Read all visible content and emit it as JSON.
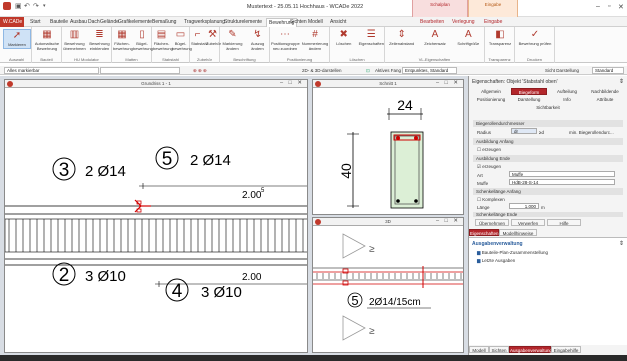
{
  "app": {
    "title": "Mustertext - 25.05.11 Hochhaus - WCADe 2022",
    "context_groups": {
      "group1": "Schalplan",
      "group2": "Eingabe"
    },
    "qat_icons": [
      "app-logo-icon",
      "save-icon",
      "undo-icon",
      "redo-icon",
      "dropdown-icon"
    ],
    "window_buttons": {
      "minimize": "–",
      "restore": "▫",
      "close": "✕"
    }
  },
  "ribbon_tabs": [
    {
      "label": "W.CADe",
      "kind": "file"
    },
    {
      "label": "Start"
    },
    {
      "label": "Bauteile"
    },
    {
      "label": "Ausbau"
    },
    {
      "label": "Dach"
    },
    {
      "label": "Gelände"
    },
    {
      "label": "Grafikelemente"
    },
    {
      "label": "Bemaßung"
    },
    {
      "label": "Tragwerksplanung"
    },
    {
      "label": "Strukturelemente"
    },
    {
      "label": "Bewehrung",
      "active": true
    },
    {
      "label": "Sichten"
    },
    {
      "label": "Modell"
    },
    {
      "label": "Ansicht"
    },
    {
      "label": "Bearbeiten",
      "context": true
    },
    {
      "label": "Verlegung",
      "context": true
    },
    {
      "label": "Eingabe",
      "context": true
    }
  ],
  "ribbon_groups": [
    {
      "label": "Auswahl",
      "buttons": [
        {
          "label": "Markieren",
          "icon": "cursor-icon",
          "glyph": "➚",
          "selected": true
        }
      ]
    },
    {
      "label": "Bauteil",
      "buttons": [
        {
          "label": "Automatische Bewehrung",
          "icon": "auto-rebar-icon",
          "glyph": "▦"
        }
      ]
    },
    {
      "label": "HU Modulator",
      "buttons": [
        {
          "label": "Bewehrung übernehmen",
          "icon": "rebar-take-icon",
          "glyph": "▥"
        },
        {
          "label": "Bewehrung einblenden",
          "icon": "rebar-show-icon",
          "glyph": "≣"
        }
      ]
    },
    {
      "label": "Matten",
      "buttons": [
        {
          "label": "Flächen-bewehrung",
          "icon": "mesh-icon",
          "glyph": "▦"
        },
        {
          "label": "Bügel-bewehrung",
          "icon": "stirrup-icon",
          "glyph": "▯"
        }
      ]
    },
    {
      "label": "Stabstahl",
      "buttons": [
        {
          "label": "Flächen-bewehrung",
          "icon": "bar-area-icon",
          "glyph": "▤"
        },
        {
          "label": "Bügel-bewehrung",
          "icon": "bar-stirrup-icon",
          "glyph": "▭"
        }
      ]
    },
    {
      "label": "Zubehör",
      "buttons": [
        {
          "label": "Stabstahl",
          "icon": "bar-icon",
          "glyph": "⌐"
        },
        {
          "label": "Zubehör",
          "icon": "accessory-icon",
          "glyph": "⚒"
        }
      ]
    },
    {
      "label": "Beschriftung",
      "buttons": [
        {
          "label": "Markierung ändern",
          "icon": "marking-icon",
          "glyph": "✎"
        },
        {
          "label": "Auszug ändern",
          "icon": "extract-icon",
          "glyph": "↯"
        }
      ]
    },
    {
      "label": "Positionierung",
      "buttons": [
        {
          "label": "Positionsgruppe neu zuordnen",
          "icon": "posgroup-icon",
          "glyph": "⋯"
        },
        {
          "label": "Nummerierung ändern",
          "icon": "numbering-icon",
          "glyph": "#"
        }
      ]
    },
    {
      "label": "Löschen",
      "buttons": [
        {
          "label": "Löschen",
          "icon": "delete-icon",
          "glyph": "✖"
        },
        {
          "label": "Eigenschaften",
          "icon": "properties-icon",
          "glyph": "☰"
        }
      ]
    },
    {
      "label": "VL-Eigenschaften",
      "buttons": [
        {
          "label": "Zeilenabstand",
          "icon": "spacing-icon",
          "glyph": "⇕"
        },
        {
          "label": "Zeichensatz",
          "icon": "font-icon",
          "glyph": "A"
        },
        {
          "label": "Schriftgröße",
          "icon": "fontsize-icon",
          "glyph": "A"
        }
      ]
    },
    {
      "label": "Transparenz",
      "buttons": [
        {
          "label": "Transparenz",
          "icon": "transparency-icon",
          "glyph": "◧"
        }
      ]
    },
    {
      "label": "Drucken",
      "buttons": [
        {
          "label": "Bewehrung prüfen",
          "icon": "check-rebar-icon",
          "glyph": "✓"
        }
      ]
    }
  ],
  "command_bar": {
    "layer_select": "Alles markierbar",
    "layer2": "",
    "mode_label": "2D- & 3D-darstellen",
    "snap_label": "Aktives Fang",
    "snap_options": "Entpunktes, Standard",
    "right_select": "Sicht Darstellung",
    "right_value": "Standard"
  },
  "views": [
    {
      "title": "Grundriss 1 - 1"
    },
    {
      "title": "Schnitt 1"
    },
    {
      "title": "3D"
    }
  ],
  "view1": {
    "labels_upper": [
      {
        "num": "3",
        "text": "2 Ø14"
      },
      {
        "num": "5",
        "text": "2 Ø14"
      }
    ],
    "dim_upper": "2.00",
    "dim_upper_sup": "5",
    "labels_lower": [
      {
        "num": "2",
        "text": "3 Ø10"
      },
      {
        "num": "4",
        "text": "3 Ø10"
      }
    ],
    "dim_lower": "2.00"
  },
  "view2": {
    "dim_width": "24",
    "dim_height": "40"
  },
  "view3": {
    "num": "5",
    "text": "2Ø14/15cm",
    "sym": "≥"
  },
  "properties_panel": {
    "title": "Eigenschaften: Objekt 'Stabstahl oben'",
    "tabs_row1": [
      "Allgemein",
      "Biegeform",
      "Aufteilung",
      "Nachbildende"
    ],
    "tabs_row2": [
      "Positionierung",
      "Darstellung",
      "Info",
      "Attribute"
    ],
    "tab_row3": "Sichtbarkeit",
    "active_tab": "Biegeform",
    "section1": "Biegerollendurchmesser",
    "radius_label": "Radius",
    "radius_value": "dr",
    "radius_unit": "≥d",
    "radius_note": "min. Biegerollendurc...",
    "section2": "Ausbildung Anfang",
    "anfang_check": "erzeugen",
    "section3": "Ausbildung Ende",
    "ende_check": "erzeugen",
    "art_label": "Art",
    "art_value": "Muffe",
    "muffe_label": "Muffe",
    "muffe_value": "HdB-28-S-14",
    "section4": "Schenkellänge Anfang",
    "kompl_check": "Komplexen",
    "laenge_label": "Länge",
    "laenge_value": "1.000",
    "laenge_unit": "m",
    "section5": "Schenkellänge Ende",
    "buttons": [
      "Übernehmen",
      "Verwerfen",
      "Hilfe"
    ],
    "lower_tabs": [
      "Eigenschaften",
      "Modellhinweise"
    ],
    "aux_title": "Ausgabenverwaltung",
    "aux_items": [
      "Bauteile-Plan-Zusammenstellung",
      "Letzte Ausgaben"
    ],
    "bottom_tabs": [
      "Modell",
      "Sichten",
      "Ausgabenverwaltung",
      "Eingabehilfe"
    ]
  }
}
